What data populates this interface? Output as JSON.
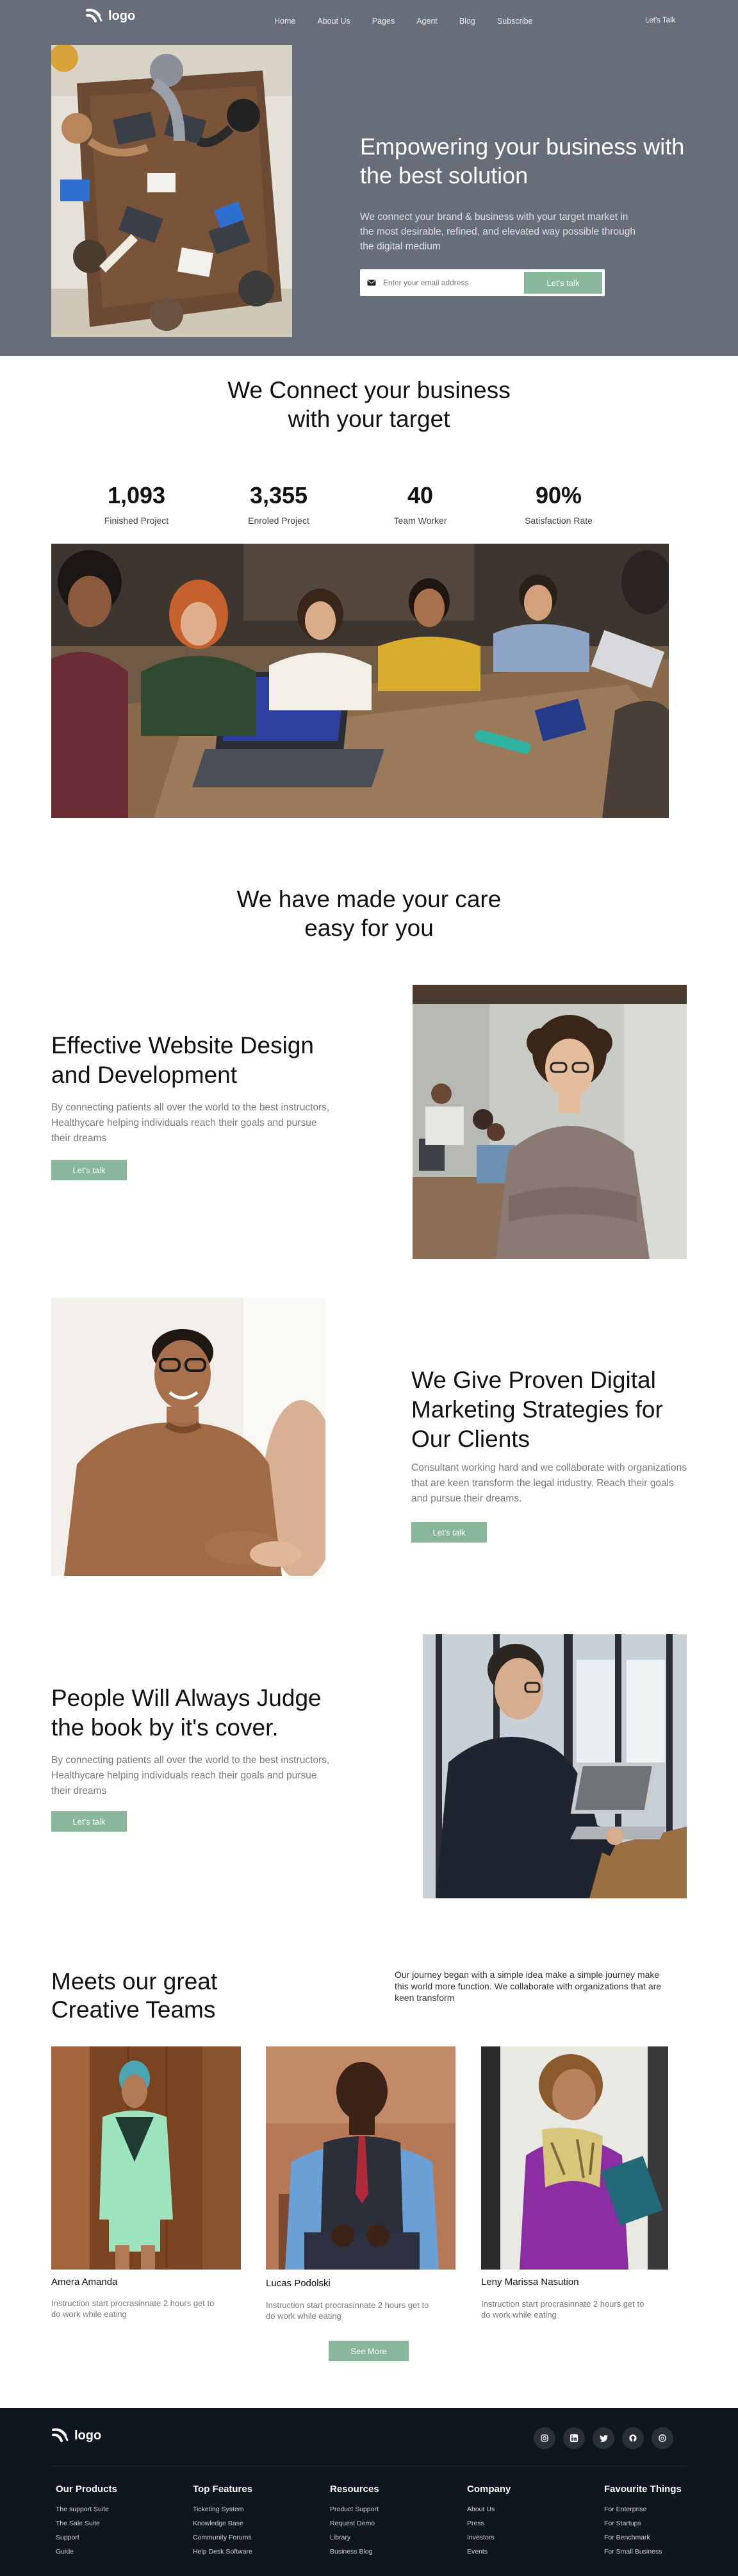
{
  "header": {
    "logo_text": "logo",
    "nav": [
      "Home",
      "About Us",
      "Pages",
      "Agent",
      "Blog",
      "Subscribe"
    ],
    "cta": "Let's Talk"
  },
  "hero": {
    "title": "Empowering your business with the best solution",
    "subtitle": "We connect your brand & business with your target market in the most desirable, refined, and elevated way possible through the digital medium",
    "email_placeholder": "Enter your email address",
    "button": "Let's talk"
  },
  "connect": {
    "title_line1": "We Connect your business",
    "title_line2": "with your target",
    "stats": [
      {
        "value": "1,093",
        "label": "Finished Project"
      },
      {
        "value": "3,355",
        "label": "Enroled Project"
      },
      {
        "value": "40",
        "label": "Team Worker"
      },
      {
        "value": "90%",
        "label": "Satisfaction Rate"
      }
    ]
  },
  "care": {
    "title_line1": "We have made your care",
    "title_line2": "easy for you"
  },
  "features": [
    {
      "title": "Effective Website Design and Development",
      "text": "By connecting patients all over the world to the best instructors, Healthycare helping individuals reach their goals and pursue their dreams",
      "button": "Let's talk"
    },
    {
      "title": "We Give Proven Digital Marketing Strategies for Our Clients",
      "text": "Consultant working hard and we collaborate with organizations that are keen transform the legal industry. Reach their goals and pursue their dreams.",
      "button": "Let's talk"
    },
    {
      "title": "People Will Always Judge the book by it's cover.",
      "text": "By connecting patients all over the world to the best instructors, Healthycare helping individuals reach their goals and pursue their dreams",
      "button": "Let's talk"
    }
  ],
  "team": {
    "title_line1": "Meets our great",
    "title_line2": "Creative Teams",
    "intro": "Our journey began with a simple idea make a simple journey make this world more function. We collaborate with organizations that are keen transform",
    "members": [
      {
        "name": "Amera Amanda",
        "text": "Instruction start procrasinnate 2 hours get to do work while eating"
      },
      {
        "name": "Lucas Podolski",
        "text": "Instruction start procrasinnate 2 hours get to do work while eating"
      },
      {
        "name": "Leny Marissa Nasution",
        "text": "Instruction start procrasinnate 2 hours get to do work while eating"
      }
    ],
    "button": "See More"
  },
  "footer": {
    "logo_text": "logo",
    "socials": [
      "instagram-icon",
      "linkedin-icon",
      "twitter-icon",
      "github-icon",
      "dribbble-icon"
    ],
    "columns": [
      {
        "title": "Our Products",
        "items": [
          "The support Suite",
          "The Sale Suite",
          "Support",
          "Guide"
        ]
      },
      {
        "title": "Top Features",
        "items": [
          "Ticketing System",
          "Knowledge Base",
          "Community Forums",
          "Help Desk Software"
        ]
      },
      {
        "title": "Resources",
        "items": [
          "Product Support",
          "Request Demo",
          "Library",
          "Business Blog"
        ]
      },
      {
        "title": "Company",
        "items": [
          "About Us",
          "Press",
          "Investors",
          "Events"
        ]
      },
      {
        "title": "Favourite Things",
        "items": [
          "For Enterprise",
          "For Startups",
          "For Benchmark",
          "For Small Business"
        ]
      }
    ]
  },
  "colors": {
    "hero_bg": "#676e79",
    "accent": "#89b79b",
    "footer_bg": "#10161f"
  }
}
